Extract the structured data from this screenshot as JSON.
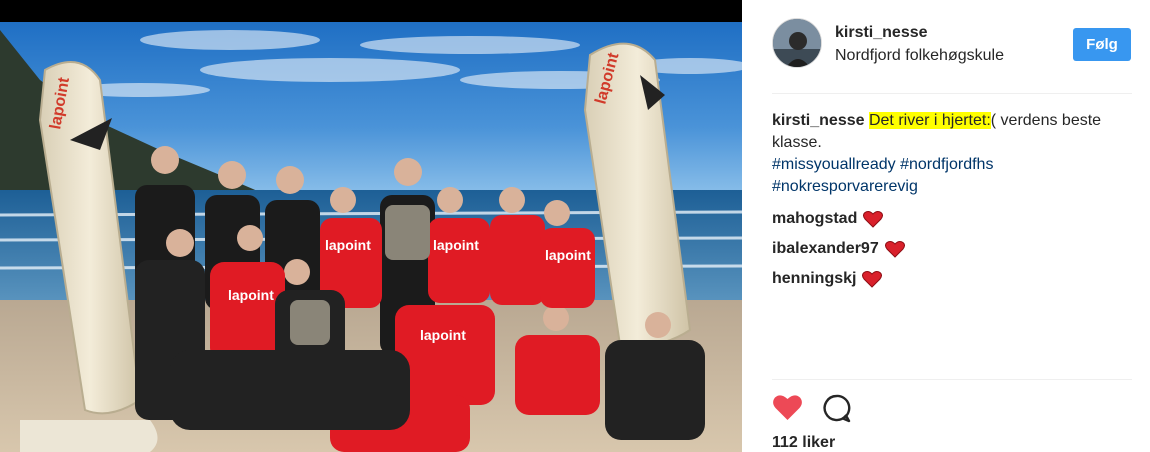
{
  "post": {
    "author": "kirsti_nesse",
    "location": "Nordfjord folkehøgskule",
    "follow_label": "Følg",
    "caption": {
      "username": "kirsti_nesse",
      "highlighted_text": "Det river i hjertet:",
      "text": "( verdens beste klasse.",
      "hashtags": [
        "#missyouallready",
        "#nordfjordfhs",
        "#nokresporvarerevig"
      ]
    },
    "comments": [
      {
        "username": "mahogstad"
      },
      {
        "username": "ibalexander97"
      },
      {
        "username": "henningskj"
      }
    ],
    "likes": "112 liker"
  },
  "photo": {
    "board_brand": "lapoint",
    "shirt_brand": "lapoint"
  },
  "colors": {
    "follow_button": "#3897f0",
    "like_heart": "#ed4956",
    "hashtag": "#003569",
    "highlight": "#ffff00",
    "shirt_red": "#e01b24"
  },
  "icons": {
    "like": "heart-icon",
    "comment": "speech-bubble-icon",
    "comment_heart": "red-heart-emoji-icon"
  }
}
